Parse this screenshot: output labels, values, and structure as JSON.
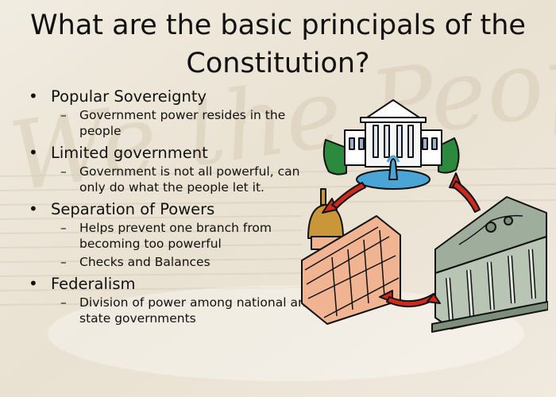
{
  "slide": {
    "title": "What are the basic principals of the Constitution?",
    "background_text": "We the People",
    "bullets": [
      {
        "label": "Popular Sovereignty",
        "subs": [
          "Government power resides in the people"
        ]
      },
      {
        "label": "Limited government",
        "subs": [
          "Government is not all powerful, can only do what the people let it."
        ]
      },
      {
        "label": "Separation of Powers",
        "subs": [
          "Helps prevent one branch from becoming too powerful",
          "Checks and Balances"
        ]
      },
      {
        "label": "Federalism",
        "subs": [
          "Division of power among national and state governments"
        ]
      }
    ]
  },
  "illustration": {
    "icons": [
      "white-house-icon",
      "capitol-icon",
      "supreme-court-icon",
      "cycle-arrow-icon"
    ],
    "colors": {
      "arrow": "#cc2a1f",
      "court": "#9fae9c",
      "capitol": "#f1b493",
      "dome": "#c9963a",
      "shrub": "#2b8a3e",
      "fountain": "#4aa5d6"
    }
  }
}
